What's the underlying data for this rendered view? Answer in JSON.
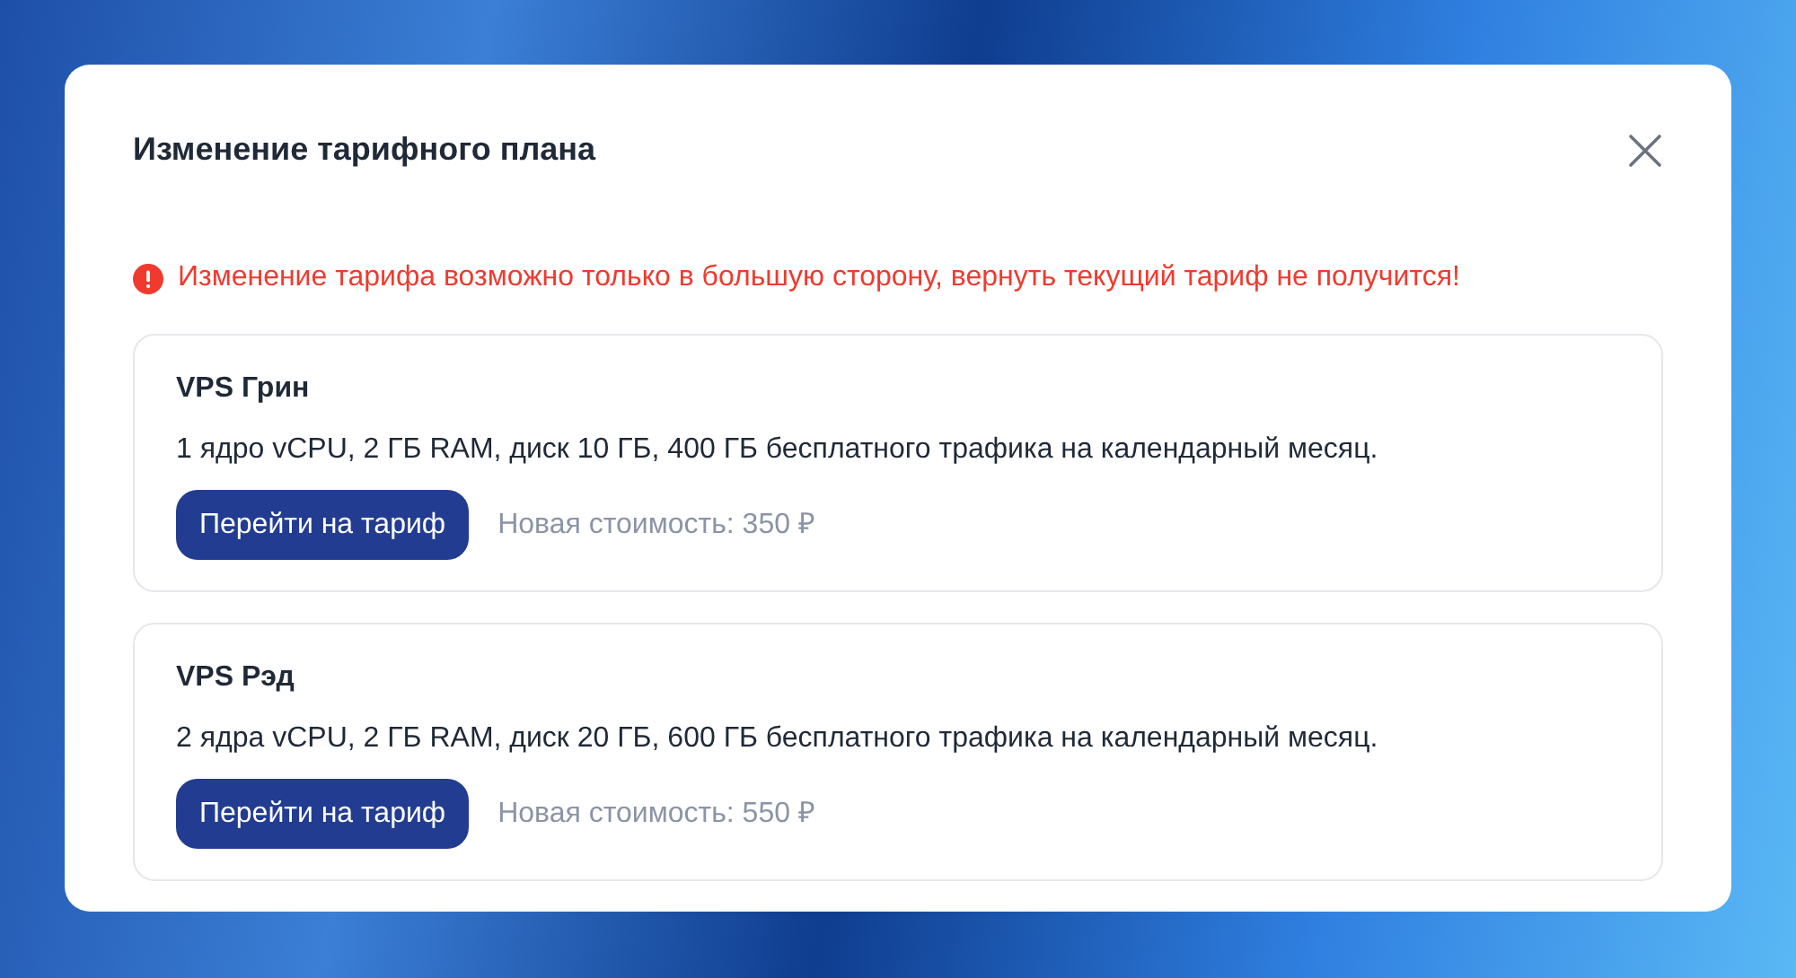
{
  "dialog": {
    "title": "Изменение тарифного плана"
  },
  "warning": "Изменение тарифа возможно только в большую сторону, вернуть текущий тариф не получится!",
  "plans": [
    {
      "name": "VPS Грин",
      "description": "1 ядро vCPU, 2 ГБ RAM, диск 10 ГБ, 400 ГБ бесплатного трафика на календарный месяц.",
      "button": "Перейти на тариф",
      "price": "Новая стоимость: 350 ₽"
    },
    {
      "name": "VPS Рэд",
      "description": "2 ядра vCPU, 2 ГБ RAM, диск 20 ГБ, 600 ГБ бесплатного трафика на календарный месяц.",
      "button": "Перейти на тариф",
      "price": "Новая стоимость: 550 ₽"
    }
  ]
}
